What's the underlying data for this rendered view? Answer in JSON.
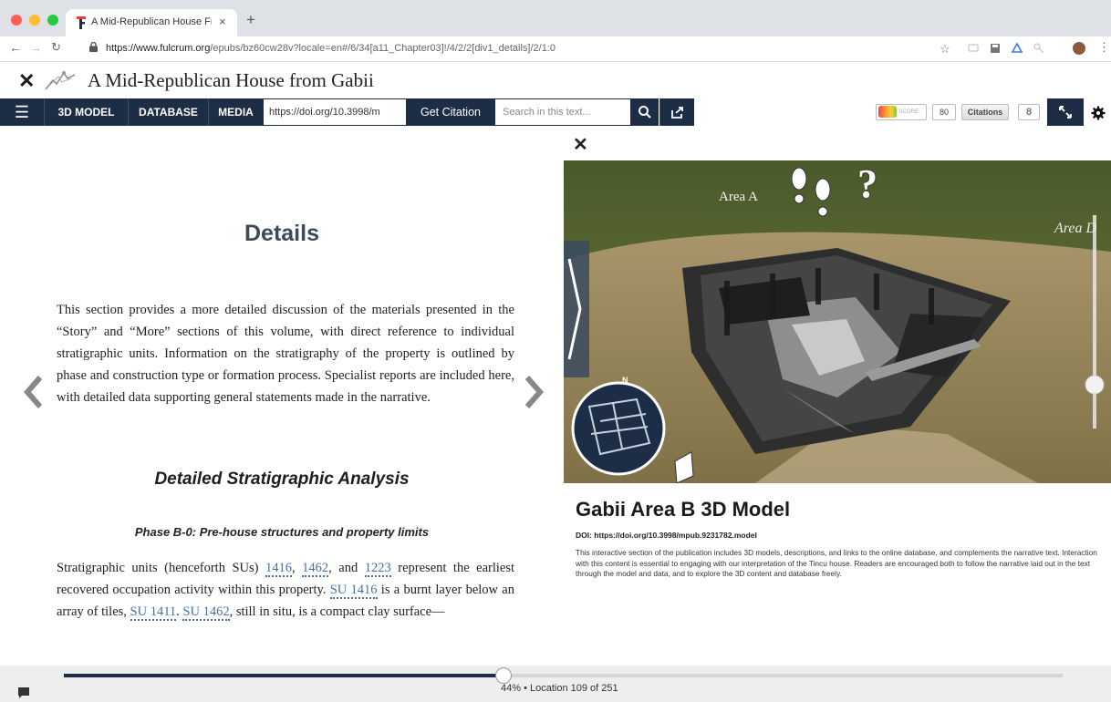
{
  "browser": {
    "tab_title": "A Mid-Republican House From",
    "tab_close": "×",
    "new_tab": "+",
    "url_host": "https://www.fulcrum.org",
    "url_path": "/epubs/bz60cw28v?locale=en#/6/34[a11_Chapter03]!/4/2/2[div1_details]/2/1:0",
    "traffic_colors": [
      "#ff5f57",
      "#febc2e",
      "#28c840"
    ]
  },
  "app": {
    "close_glyph": "✕",
    "title": "A Mid-Republican House from Gabii"
  },
  "toolbar": {
    "menu_glyph": "☰",
    "model_label": "3D MODEL",
    "database_label": "DATABASE",
    "media_label": "MEDIA",
    "doi_value": "https://doi.org/10.3998/m",
    "citation_label": "Get Citation",
    "search_placeholder": "Search in this text...",
    "altmetric_score_label": "SCORE",
    "altmetric_score": "80",
    "citations_label": "Citations",
    "citations_count": "8",
    "accent": "#1c2d45"
  },
  "reader": {
    "heading": "Details",
    "intro": "This section provides a more detailed discussion of the materials presented in the “Story” and “More” sections of this volume, with direct reference to individual stratigraphic units. Information on the stratigraphy of the property is outlined by phase and construction type or formation process. Specialist reports are included here, with detailed data supporting general statements made in the narrative.",
    "section_heading": "Detailed Stratigraphic Analysis",
    "subsection_heading": "Phase B-0: Pre-house structures and property limits",
    "para2": {
      "t1": "Stratigraphic units (henceforth SUs) ",
      "l1": "1416",
      "t2": ", ",
      "l2": "1462",
      "t3": ", and ",
      "l3": "1223",
      "t4": " represent the earliest recovered occupation activity within this property. ",
      "l4": "SU 1416",
      "t5": " is a burnt layer below an array of tiles, ",
      "l5": "SU 1411",
      "t6": ". ",
      "l6": "SU 1462",
      "t7": ", still in situ, is a compact clay surface—"
    }
  },
  "viewer": {
    "close_glyph": "✕",
    "area_a": "Area A",
    "area_d": "Area D",
    "help_glyph": "?",
    "compass_n": "N",
    "model_title": "Gabii Area B 3D Model",
    "model_doi": "DOI: https://doi.org/10.3998/mpub.9231782.model",
    "model_description": "This interactive section of the publication includes 3D models, descriptions, and links to the online database, and complements the narrative text. Interaction with this content is essential to engaging with our interpretation of the Tincu house. Readers are encouraged both to follow the narrative laid out in the text through the model and data, and to explore the 3D content and database freely."
  },
  "progress": {
    "percent": 44,
    "label": "44% • Location 109 of 251"
  }
}
